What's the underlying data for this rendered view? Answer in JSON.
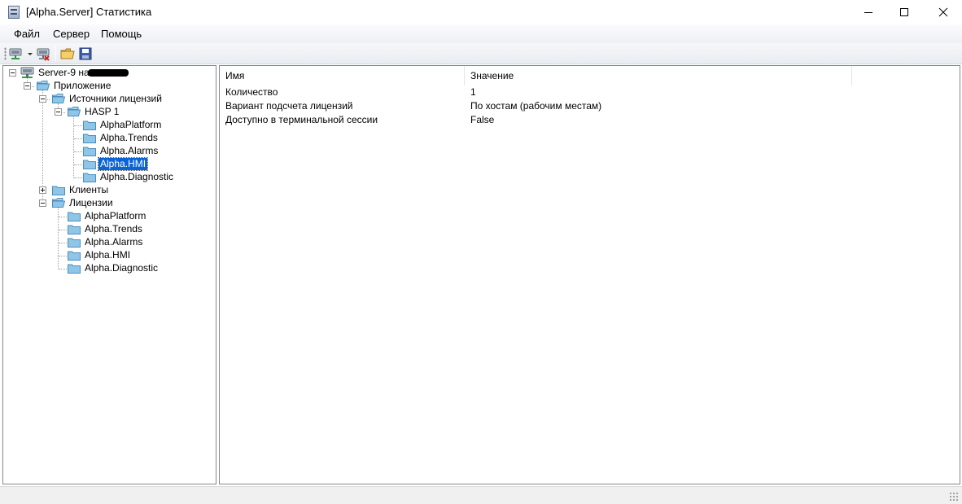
{
  "window": {
    "title": "[Alpha.Server] Статистика"
  },
  "menu": {
    "items": [
      "Файл",
      "Сервер",
      "Помощь"
    ]
  },
  "toolbar": {
    "buttons": [
      "connect-icon",
      "disconnect-icon",
      "open-folder-icon",
      "save-icon"
    ]
  },
  "tree": {
    "root": "Server-9 на",
    "app": "Приложение",
    "license_sources": "Источники лицензий",
    "hasp": "HASP 1",
    "hasp_children": [
      "AlphaPlatform",
      "Alpha.Trends",
      "Alpha.Alarms",
      "Alpha.HMI",
      "Alpha.Diagnostic"
    ],
    "selected": "Alpha.HMI",
    "clients": "Клиенты",
    "licenses": "Лицензии",
    "license_children": [
      "AlphaPlatform",
      "Alpha.Trends",
      "Alpha.Alarms",
      "Alpha.HMI",
      "Alpha.Diagnostic"
    ]
  },
  "list": {
    "columns": [
      "Имя",
      "Значение"
    ],
    "rows": [
      {
        "name": "Количество",
        "value": "1"
      },
      {
        "name": "Вариант подсчета лицензий",
        "value": "По хостам (рабочим местам)"
      },
      {
        "name": "Доступно в терминальной сессии",
        "value": "False"
      }
    ]
  },
  "colors": {
    "selection": "#0a64d7",
    "folder": "#8fc6e8"
  }
}
